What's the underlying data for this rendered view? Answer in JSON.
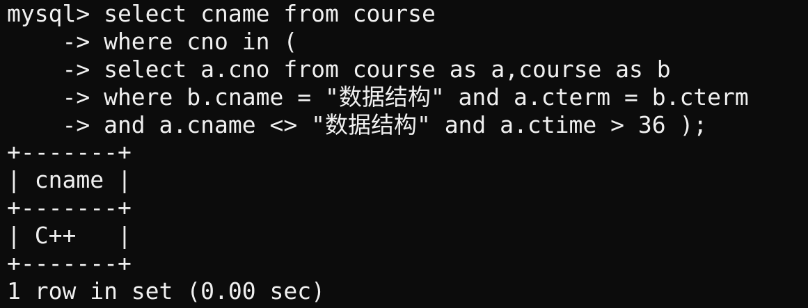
{
  "terminal": {
    "lines": [
      "mysql> select cname from course",
      "    -> where cno in (",
      "    -> select a.cno from course as a,course as b",
      "    -> where b.cname = \"数据结构\" and a.cterm = b.cterm",
      "    -> and a.cname <> \"数据结构\" and a.ctime > 36 );",
      "+-------+",
      "| cname |",
      "+-------+",
      "| C++   |",
      "+-------+",
      "1 row in set (0.00 sec)"
    ]
  },
  "colors": {
    "background": "#0c0c0c",
    "text": "#f0f0f0"
  }
}
